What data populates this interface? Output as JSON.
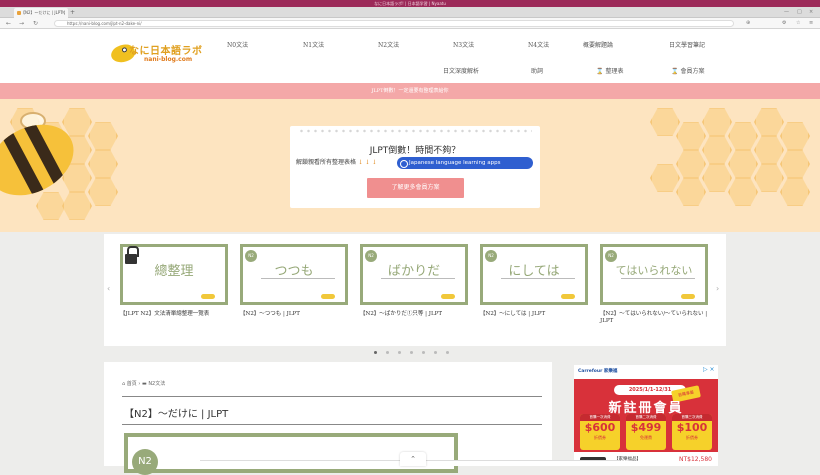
{
  "browser": {
    "window_title": "なに日本語ラボ! | 日本語学習 | Nyaatu",
    "tab_label": "【N2】〜だけに | JLPT | に...",
    "url": "https://nani-blog.com/jlpt-n2-dake-ni/"
  },
  "site": {
    "logo_text": "なに日本語ラボ",
    "logo_url": "nani-blog.com"
  },
  "menu": {
    "row1": [
      "N0文法",
      "N1文法",
      "N2文法",
      "N3文法",
      "N4文法",
      "概要解題論",
      "日文學習筆記"
    ],
    "row2": [
      "日文深度解析",
      "助詞",
      "整理表",
      "會員方案"
    ]
  },
  "notice": "JLPT倒數！一定還要有整理表給你",
  "promo": {
    "title": "JLPT倒數！時間不夠？",
    "subtitle": "解鎖親看所有整理表格",
    "arrows": "↓ ↓ ↓",
    "pill": "Japanese language learning apps",
    "cta": "了解更多會員方案"
  },
  "carousel": {
    "slides": [
      {
        "badge": "",
        "big": "總整理",
        "caption": "【JLPT N2】文法清單總整理一覽表"
      },
      {
        "badge": "N2",
        "big": "つつも",
        "caption": "【N2】〜つつも | JLPT"
      },
      {
        "badge": "N2",
        "big": "ばかりだ",
        "caption": "【N2】〜ばかりだ①只等 | JLPT"
      },
      {
        "badge": "N2",
        "big": "にしては",
        "caption": "【N2】〜にしては | JLPT"
      },
      {
        "badge": "N2",
        "big": "てはいられない",
        "caption": "【N2】〜てはいられない/〜ていられない | JLPT"
      }
    ],
    "prev": "‹",
    "next": "›"
  },
  "article": {
    "breadcrumb_home": "首頁",
    "breadcrumb_cat": "N2文法",
    "title": "【N2】〜だけに | JLPT",
    "thumb_badge": "N2"
  },
  "ad": {
    "brand": "Carrefour 家樂福",
    "period": "2025/1/1-12/31",
    "title": "新註冊會員",
    "tag": "首購專屬",
    "coupons": [
      {
        "head": "首購一次消費",
        "value": "$600",
        "sub": "折價券"
      },
      {
        "head": "首購二次消費",
        "value": "$499",
        "sub": "免運費"
      },
      {
        "head": "首購三次消費",
        "value": "$100",
        "sub": "折價券"
      }
    ],
    "product": "【家樂福品】",
    "price": "NT$12,580"
  },
  "to_top": "⌃"
}
